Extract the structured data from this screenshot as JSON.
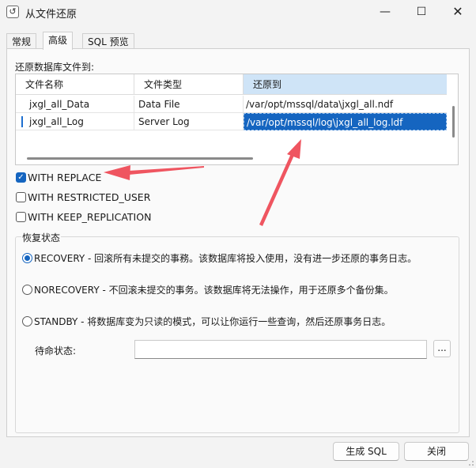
{
  "window": {
    "title": "从文件还原",
    "icon": "restore-icon",
    "controls": {
      "minimize": "—",
      "maximize": "☐",
      "close": "✕"
    }
  },
  "tabs": [
    {
      "label": "常规",
      "active": false
    },
    {
      "label": "高级",
      "active": true
    },
    {
      "label": "SQL 预览",
      "active": false
    }
  ],
  "files": {
    "label": "还原数据库文件到:",
    "columns": [
      "文件名称",
      "文件类型",
      "还原到"
    ],
    "rows": [
      {
        "name": "jxgl_all_Data",
        "type": "Data File",
        "restore_to": "/var/opt/mssql/data\\jxgl_all.ndf",
        "selected": false
      },
      {
        "name": "jxgl_all_Log",
        "type": "Server Log",
        "restore_to": "/var/opt/mssql/log\\jxgl_all_log.ldf",
        "selected": true
      }
    ]
  },
  "options": [
    {
      "label": "WITH REPLACE",
      "checked": true
    },
    {
      "label": "WITH RESTRICTED_USER",
      "checked": false
    },
    {
      "label": "WITH KEEP_REPLICATION",
      "checked": false
    }
  ],
  "recovery": {
    "title": "恢复状态",
    "selected": 0,
    "items": [
      {
        "label": "RECOVERY - 回滚所有未提交的事務。该数据库将投入使用，没有进一步还原的事务日志。"
      },
      {
        "label": "NORECOVERY - 不回滚未提交的事务。该数据库将无法操作，用于还原多个备份集。"
      },
      {
        "label": "STANDBY - 将数据库变为只读的模式，可以让你运行一些查询，然后还原事务日志。"
      }
    ],
    "standby_label": "待命状态:",
    "standby_value": "",
    "browse_label": "..."
  },
  "buttons": {
    "generate_sql": "生成 SQL",
    "close": "关闭"
  },
  "colors": {
    "accent": "#1565c0",
    "annotation_arrow": "#ef5560",
    "header_highlight": "#cfe4f7"
  }
}
